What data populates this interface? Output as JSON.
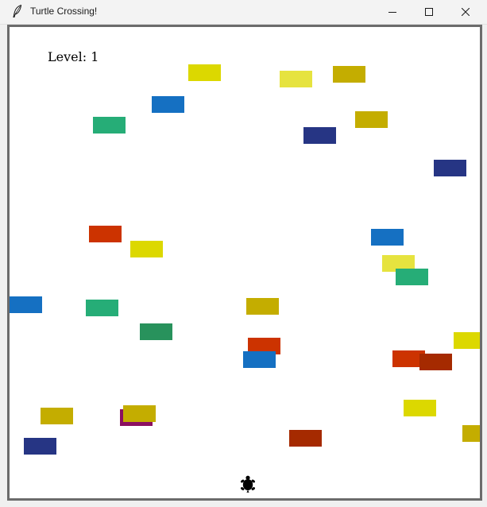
{
  "window": {
    "title": "Turtle Crossing!",
    "icon": "feather-icon",
    "controls": [
      "minimize-icon",
      "maximize-icon",
      "close-icon"
    ]
  },
  "game": {
    "level_label": "Level: 1",
    "player": "turtle",
    "palette": {
      "yellow": "#dcd800",
      "pale_yellow": "#e6e33f",
      "olive": "#c4ad00",
      "blue": "#1570c2",
      "navy": "#263584",
      "green": "#26ad77",
      "dark_green": "#28925c",
      "red": "#cc3300",
      "dark_red": "#a52a00",
      "maroon": "#8b1060"
    },
    "cars": [
      {
        "color": "#dcd800"
      },
      {
        "color": "#e6e33f"
      },
      {
        "color": "#c4ad00"
      },
      {
        "color": "#1570c2"
      },
      {
        "color": "#26ad77"
      },
      {
        "color": "#c4ad00"
      },
      {
        "color": "#263584"
      },
      {
        "color": "#263584"
      },
      {
        "color": "#cc3300"
      },
      {
        "color": "#dcd800"
      },
      {
        "color": "#1570c2"
      },
      {
        "color": "#e6e33f"
      },
      {
        "color": "#26ad77"
      },
      {
        "color": "#1570c2"
      },
      {
        "color": "#26ad77"
      },
      {
        "color": "#c4ad00"
      },
      {
        "color": "#28925c"
      },
      {
        "color": "#dcd800"
      },
      {
        "color": "#cc3300"
      },
      {
        "color": "#1570c2"
      },
      {
        "color": "#cc3300"
      },
      {
        "color": "#a52a00"
      },
      {
        "color": "#dcd800"
      },
      {
        "color": "#c4ad00"
      },
      {
        "color": "#8b1060"
      },
      {
        "color": "#c4ad00"
      },
      {
        "color": "#c4ad00"
      },
      {
        "color": "#263584"
      },
      {
        "color": "#a52a00"
      }
    ]
  }
}
